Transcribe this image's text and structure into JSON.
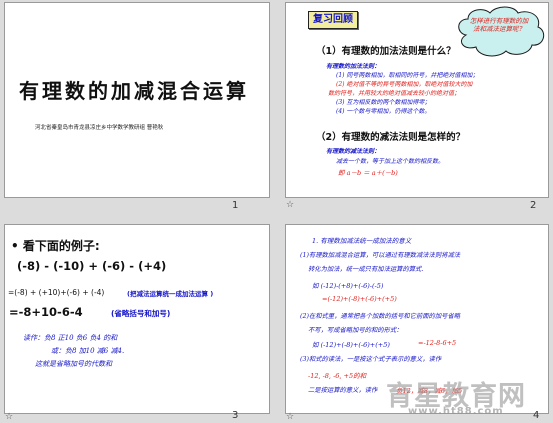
{
  "slides": {
    "s1": {
      "title": "有理数的加减混合运算",
      "subtitle": "河北省秦皇岛市青龙县凉庄乡中学数学教研组  曹艳秋",
      "page_number": "1"
    },
    "s2": {
      "header_label": "复习回顾",
      "cloud_note": "怎样进行有理数的加法和减法运算呢？",
      "q1": "（1）有理数的加法法则是什么？",
      "q1_lead": "有理数的加法法则：",
      "q1_lines": [
        "(1) 同号两数相加，取相同的符号，并把绝对值相加；",
        "(2) 绝对值不等的异号两数相加，取绝对值较大的加",
        "数的符号，并用较大的绝对值减去较小的绝对值；",
        "(3) 互为相反数的两个数相加得零；",
        "(4) 一个数与零相加，仍得这个数。"
      ],
      "q2": "（2）有理数的减法法则是怎样的？",
      "q2_lead": "有理数的减法法则：",
      "q2_line": "减去一个数，等于加上这个数的相反数。",
      "q2_formula": "即  a－b ＝ a＋(－b)",
      "page_number": "2",
      "star": "☆"
    },
    "s3": {
      "heading": "• 看下面的例子:",
      "expr1": "(-8) - (-10) + (-6) - (+4)",
      "expr2": "=(-8) + (+10)+(-6) + (-4)",
      "expr2_note": "(把减法运算统一成加法运算 )",
      "expr3": "=-8+10-6-4",
      "expr3_note": "(省略括号和加号)",
      "read1": "读作：负8 正10 负6 负4 的和",
      "read2": "或：负8 加10 减6 减4.",
      "read3": "这就是省略加号的代数和",
      "page_number": "3",
      "star": "☆"
    },
    "s4": {
      "l1": "1. 有理数加减法统一成加法的意义",
      "l2": "(1)有理数加减混合运算，可以通过有理数减法法则将减法",
      "l3": "转化为加法，统一成只有加法运算的算式.",
      "l4": "如 (-12)-(+8)+(-6)-(-5)",
      "l5": "=(-12)+(-8)+(-6)+(+5)",
      "l6": "(2)在和式里，通常把各个加数的括号和它前面的加号省略",
      "l7": "不写，写成省略加号的和的形式：",
      "l8a": "如  (-12)+(-8)+(-6)+(+5)",
      "l8b": "=-12-8-6+5",
      "l9": "(3)和式的读法，一是按这个式子表示的意义，读作",
      "l10a": "-12, -8, -6, +5的和",
      "l11a": "二是按运算的意义，读作",
      "l11b": "负12，减8，减6，加5",
      "page_number": "4",
      "star": "☆"
    }
  },
  "watermark": {
    "text": "育星教育网",
    "url": "www.ht88.com"
  },
  "colors": {
    "blue": "#1414c8",
    "red": "#e0201c",
    "title": "#101010",
    "note_box": "#2020a0"
  }
}
